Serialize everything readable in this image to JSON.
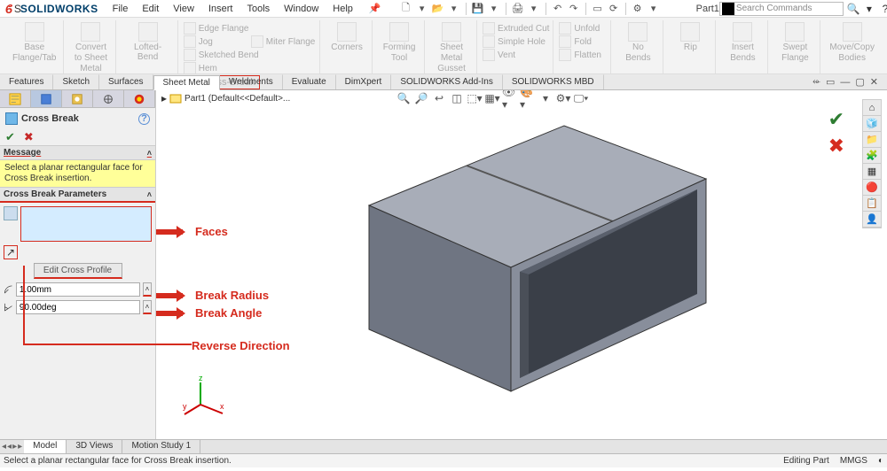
{
  "app": {
    "brand_prefix": "S",
    "brand_name": "SOLIDWORKS",
    "doc_title": "Part1"
  },
  "menu": [
    "File",
    "Edit",
    "View",
    "Insert",
    "Tools",
    "Window",
    "Help"
  ],
  "search": {
    "placeholder": "Search Commands"
  },
  "ribbon": {
    "large": [
      {
        "line1": "Base",
        "line2": "Flange/Tab"
      },
      {
        "line1": "Convert",
        "line2": "to Sheet",
        "line3": "Metal"
      },
      {
        "line1": "Lofted-Bend",
        "line2": ""
      }
    ],
    "col1": [
      "Edge Flange",
      "Miter Flange",
      "Hem"
    ],
    "col2": [
      "Jog",
      "Sketched Bend",
      "Cross-Break"
    ],
    "large2": [
      {
        "line1": "Corners",
        "line2": ""
      },
      {
        "line1": "Forming",
        "line2": "Tool"
      },
      {
        "line1": "Sheet",
        "line2": "Metal",
        "line3": "Gusset"
      }
    ],
    "col3": [
      "Extruded Cut",
      "Simple Hole",
      "Vent"
    ],
    "col4": [
      "Unfold",
      "Fold",
      "Flatten"
    ],
    "large3": [
      {
        "line1": "No",
        "line2": "Bends"
      },
      {
        "line1": "Rip",
        "line2": ""
      },
      {
        "line1": "Insert",
        "line2": "Bends"
      },
      {
        "line1": "Swept",
        "line2": "Flange"
      },
      {
        "line1": "Move/Copy",
        "line2": "Bodies"
      }
    ]
  },
  "tabs": [
    "Features",
    "Sketch",
    "Surfaces",
    "Sheet Metal",
    "Weldments",
    "Evaluate",
    "DimXpert",
    "SOLIDWORKS Add-Ins",
    "SOLIDWORKS MBD"
  ],
  "active_tab": "Sheet Metal",
  "feature_tree": {
    "root": "Part1  (Default<<Default>..."
  },
  "pm": {
    "title": "Cross Break",
    "msg_header": "Message",
    "msg": "Select a planar rectangular face for Cross Break insertion.",
    "params_header": "Cross Break Parameters",
    "edit_btn": "Edit Cross Profile",
    "radius": "1.00mm",
    "angle": "90.00deg"
  },
  "bottom_tabs": [
    "Model",
    "3D Views",
    "Motion Study 1"
  ],
  "status": {
    "hint": "Select a planar rectangular face for Cross Break insertion.",
    "context": "Editing Part",
    "units": "MMGS"
  },
  "annotations": {
    "faces": "Faces",
    "radius": "Break Radius",
    "angle": "Break Angle",
    "reverse": "Reverse Direction"
  }
}
